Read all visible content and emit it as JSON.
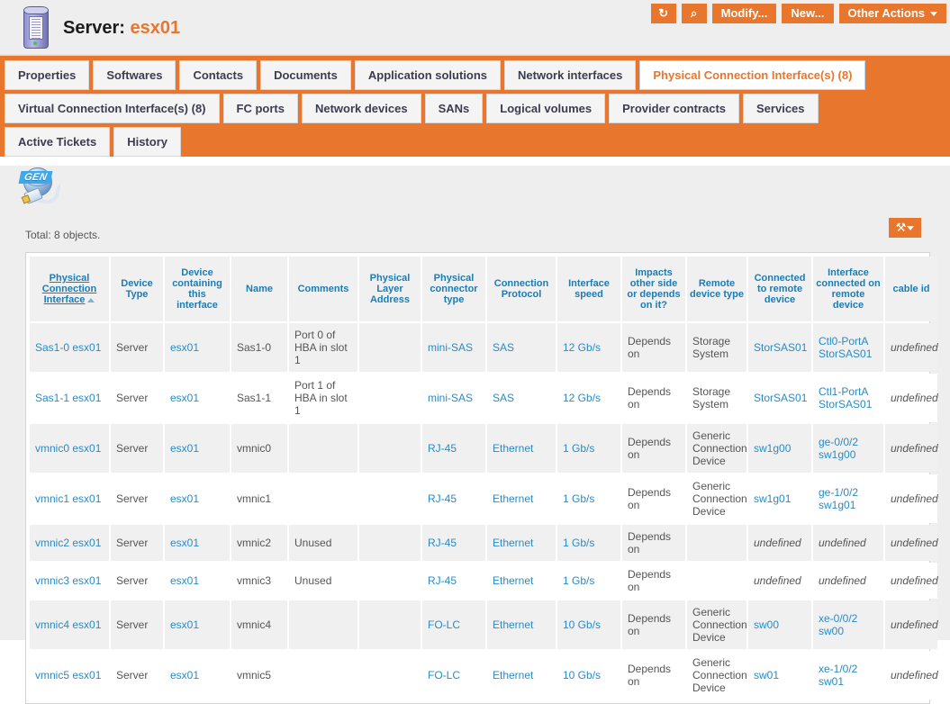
{
  "header": {
    "object_class": "Server:",
    "object_name": "esx01",
    "icon": "server-icon"
  },
  "toolbar": {
    "refresh_label": "↻",
    "refresh_name": "refresh-icon",
    "search_label": "⌕",
    "search_name": "search-icon",
    "modify_label": "Modify...",
    "new_label": "New...",
    "other_actions_label": "Other Actions"
  },
  "tabs": {
    "rows": [
      [
        {
          "label": "Properties",
          "active": false
        },
        {
          "label": "Softwares",
          "active": false
        },
        {
          "label": "Contacts",
          "active": false
        },
        {
          "label": "Documents",
          "active": false
        },
        {
          "label": "Application solutions",
          "active": false
        },
        {
          "label": "Network interfaces",
          "active": false
        },
        {
          "label": "Physical Connection Interface(s) (8)",
          "active": true
        }
      ],
      [
        {
          "label": "Virtual Connection Interface(s) (8)",
          "active": false
        },
        {
          "label": "FC ports",
          "active": false
        },
        {
          "label": "Network devices",
          "active": false
        },
        {
          "label": "SANs",
          "active": false
        },
        {
          "label": "Logical volumes",
          "active": false
        },
        {
          "label": "Provider contracts",
          "active": false
        },
        {
          "label": "Services",
          "active": false
        }
      ],
      [
        {
          "label": "Active Tickets",
          "active": false
        },
        {
          "label": "History",
          "active": false
        }
      ]
    ]
  },
  "panel": {
    "icon_name": "physical-connection-interface-icon",
    "icon_badge": "GEN",
    "total_label": "Total: 8 objects.",
    "export_icon": "tools-icon"
  },
  "table": {
    "columns": [
      "Physical Connection Interface",
      "Device Type",
      "Device containing this interface",
      "Name",
      "Comments",
      "Physical Layer Address",
      "Physical connector type",
      "Connection Protocol",
      "Interface speed",
      "Impacts other side or depends on it?",
      "Remote device type",
      "Connected to remote device",
      "Interface connected on remote device",
      "cable id"
    ],
    "sorted_column_index": 0,
    "sort_direction": "asc",
    "rows": [
      {
        "cells": [
          "Sas1-0 esx01",
          "Server",
          "esx01",
          "Sas1-0",
          "Port 0 of HBA in slot 1",
          "",
          "mini-SAS",
          "SAS",
          "12 Gb/s",
          "Depends on",
          "Storage System",
          "StorSAS01",
          "Ctl0-PortA StorSAS01",
          "undefined"
        ],
        "kinds": [
          "lnk",
          "txt",
          "lnk",
          "txt",
          "txt",
          "txt",
          "lnk",
          "lnk",
          "lnk",
          "txt",
          "txt",
          "lnk",
          "lnk",
          "undef"
        ]
      },
      {
        "cells": [
          "Sas1-1 esx01",
          "Server",
          "esx01",
          "Sas1-1",
          "Port 1 of HBA in slot 1",
          "",
          "mini-SAS",
          "SAS",
          "12 Gb/s",
          "Depends on",
          "Storage System",
          "StorSAS01",
          "Ctl1-PortA StorSAS01",
          "undefined"
        ],
        "kinds": [
          "lnk",
          "txt",
          "lnk",
          "txt",
          "txt",
          "txt",
          "lnk",
          "lnk",
          "lnk",
          "txt",
          "txt",
          "lnk",
          "lnk",
          "undef"
        ]
      },
      {
        "cells": [
          "vmnic0 esx01",
          "Server",
          "esx01",
          "vmnic0",
          "",
          "",
          "RJ-45",
          "Ethernet",
          "1 Gb/s",
          "Depends on",
          "Generic Connection Device",
          "sw1g00",
          "ge-0/0/2 sw1g00",
          "undefined"
        ],
        "kinds": [
          "lnk",
          "txt",
          "lnk",
          "txt",
          "txt",
          "txt",
          "lnk",
          "lnk",
          "lnk",
          "txt",
          "txt",
          "lnk",
          "lnk",
          "undef"
        ]
      },
      {
        "cells": [
          "vmnic1 esx01",
          "Server",
          "esx01",
          "vmnic1",
          "",
          "",
          "RJ-45",
          "Ethernet",
          "1 Gb/s",
          "Depends on",
          "Generic Connection Device",
          "sw1g01",
          "ge-1/0/2 sw1g01",
          "undefined"
        ],
        "kinds": [
          "lnk",
          "txt",
          "lnk",
          "txt",
          "txt",
          "txt",
          "lnk",
          "lnk",
          "lnk",
          "txt",
          "txt",
          "lnk",
          "lnk",
          "undef"
        ]
      },
      {
        "cells": [
          "vmnic2 esx01",
          "Server",
          "esx01",
          "vmnic2",
          "Unused",
          "",
          "RJ-45",
          "Ethernet",
          "1 Gb/s",
          "Depends on",
          "",
          "undefined",
          "undefined",
          "undefined"
        ],
        "kinds": [
          "lnk",
          "txt",
          "lnk",
          "txt",
          "txt",
          "txt",
          "lnk",
          "lnk",
          "lnk",
          "txt",
          "txt",
          "undef",
          "undef",
          "undef"
        ]
      },
      {
        "cells": [
          "vmnic3 esx01",
          "Server",
          "esx01",
          "vmnic3",
          "Unused",
          "",
          "RJ-45",
          "Ethernet",
          "1 Gb/s",
          "Depends on",
          "",
          "undefined",
          "undefined",
          "undefined"
        ],
        "kinds": [
          "lnk",
          "txt",
          "lnk",
          "txt",
          "txt",
          "txt",
          "lnk",
          "lnk",
          "lnk",
          "txt",
          "txt",
          "undef",
          "undef",
          "undef"
        ]
      },
      {
        "cells": [
          "vmnic4 esx01",
          "Server",
          "esx01",
          "vmnic4",
          "",
          "",
          "FO-LC",
          "Ethernet",
          "10 Gb/s",
          "Depends on",
          "Generic Connection Device",
          "sw00",
          "xe-0/0/2 sw00",
          "undefined"
        ],
        "kinds": [
          "lnk",
          "txt",
          "lnk",
          "txt",
          "txt",
          "txt",
          "lnk",
          "lnk",
          "lnk",
          "txt",
          "txt",
          "lnk",
          "lnk",
          "undef"
        ]
      },
      {
        "cells": [
          "vmnic5 esx01",
          "Server",
          "esx01",
          "vmnic5",
          "",
          "",
          "FO-LC",
          "Ethernet",
          "10 Gb/s",
          "Depends on",
          "Generic Connection Device",
          "sw01",
          "xe-1/0/2 sw01",
          "undefined"
        ],
        "kinds": [
          "lnk",
          "txt",
          "lnk",
          "txt",
          "txt",
          "txt",
          "lnk",
          "lnk",
          "lnk",
          "txt",
          "txt",
          "lnk",
          "lnk",
          "undef"
        ]
      }
    ]
  },
  "colors": {
    "accent": "#e8762c",
    "link": "#2a8bc4",
    "header_link": "#1a7db5",
    "page_bg": "#eeeeee"
  }
}
